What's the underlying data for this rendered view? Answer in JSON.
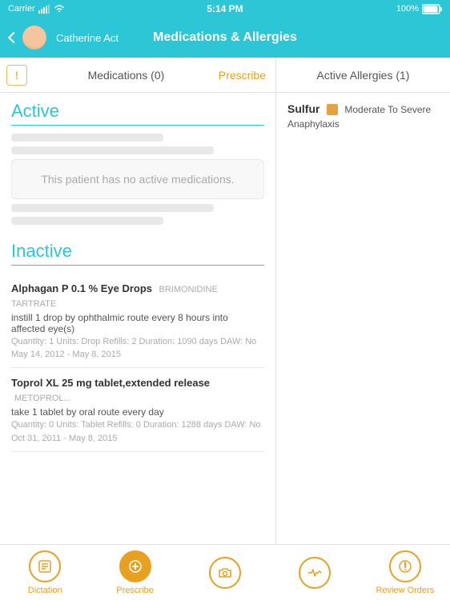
{
  "statusBar": {
    "carrier": "Carrier",
    "time": "5:14 PM",
    "battery": "100%"
  },
  "navBar": {
    "back_label": "",
    "patient_name": "Catherine Act",
    "title": "Medications & Allergies"
  },
  "leftPanel": {
    "tab_label": "Medications (0)",
    "prescribe_label": "Prescribe",
    "active_section_title": "Active",
    "no_meds_message": "This patient has no active medications.",
    "inactive_section_title": "Inactive",
    "medications": [
      {
        "name": "Alphagan P 0.1 % Eye Drops",
        "generic": "BRIMONIDINE TARTRATE",
        "instruction": "instill 1 drop by ophthalmic route  every 8 hours into affected eye(s)",
        "details": "Quantity: 1   Units: Drop   Refills: 2   Duration: 1090 days   DAW: No",
        "dates": "May 14, 2012 - May 8, 2015"
      },
      {
        "name": "Toprol XL 25 mg tablet,extended release",
        "generic": "METOPROL...",
        "instruction": "take 1 tablet by oral route  every day",
        "details": "Quantity: 0   Units: Tablet   Refills: 0   Duration: 1288 days   DAW: No",
        "dates": "Oct 31, 2011 - May 8, 2015"
      }
    ]
  },
  "rightPanel": {
    "tab_label": "Active Allergies (1)",
    "allergies": [
      {
        "name": "Sulfur",
        "severity": "Moderate To Severe",
        "reaction": "Anaphylaxis"
      }
    ]
  },
  "bottomBar": {
    "tabs": [
      {
        "label": "Dictation",
        "icon": "dictation"
      },
      {
        "label": "Prescribe",
        "icon": "prescribe",
        "active": true
      },
      {
        "label": "",
        "icon": "camera",
        "active": false
      },
      {
        "label": "",
        "icon": "heartbeat"
      },
      {
        "label": "Review Orders",
        "icon": "orders"
      }
    ]
  }
}
